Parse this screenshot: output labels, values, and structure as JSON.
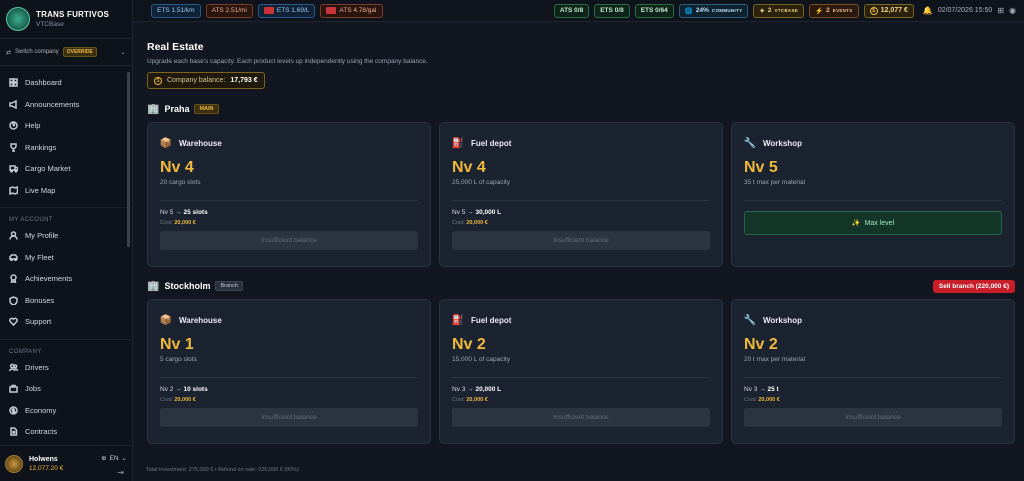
{
  "brand": {
    "title": "TRANS FURTIVOS",
    "subtitle": "VTCBase"
  },
  "switch": {
    "label": "Switch company",
    "badge": "OVERRIDE"
  },
  "nav": {
    "main": [
      {
        "label": "Dashboard",
        "icon": "grid-icon"
      },
      {
        "label": "Announcements",
        "icon": "megaphone-icon"
      },
      {
        "label": "Help",
        "icon": "help-icon"
      },
      {
        "label": "Rankings",
        "icon": "trophy-icon"
      },
      {
        "label": "Cargo Market",
        "icon": "truck-icon"
      },
      {
        "label": "Live Map",
        "icon": "map-icon"
      }
    ],
    "account_title": "MY ACCOUNT",
    "account": [
      {
        "label": "My Profile",
        "icon": "user-icon"
      },
      {
        "label": "My Fleet",
        "icon": "car-icon"
      },
      {
        "label": "Achievements",
        "icon": "badge-icon"
      },
      {
        "label": "Bonuses",
        "icon": "shield-icon"
      },
      {
        "label": "Support",
        "icon": "heart-icon"
      }
    ],
    "company_title": "COMPANY",
    "company": [
      {
        "label": "Drivers",
        "icon": "users-icon"
      },
      {
        "label": "Jobs",
        "icon": "briefcase-icon"
      },
      {
        "label": "Economy",
        "icon": "dollar-icon"
      },
      {
        "label": "Contracts",
        "icon": "document-icon"
      }
    ]
  },
  "user": {
    "name": "Holwens",
    "balance": "12,077.20 €",
    "lang": "EN"
  },
  "topbar": {
    "ets_rate": "ETS 1.51/km",
    "ats_rate": "ATS 2.51/mi",
    "ets_fuel": "ETS 1.69/L",
    "ats_fuel": "ATS 4.78/gal",
    "ats_stat": "ATS 0/8",
    "ets_stat": "ETS 0/8",
    "ets_stat2": "ETS 0/64",
    "community_value": "24%",
    "community_label": "COMMUNITY",
    "vtcbase_value": "2",
    "vtcbase_label": "VTCBASE",
    "events_value": "2",
    "events_label": "EVENTS",
    "money": "12,077 €",
    "date": "02/07/2026 15:50"
  },
  "page": {
    "title": "Real Estate",
    "description": "Upgrade each base's capacity. Each product levels up independently using the company balance.",
    "balance_label": "Company balance:",
    "balance_value": "17,793 €"
  },
  "bases": [
    {
      "name": "Praha",
      "tag": "MAIN",
      "cards": [
        {
          "name": "Warehouse",
          "icon": "box-icon",
          "level": "Nv 4",
          "capacity": "20 cargo slots",
          "next": "Nv 5 → ",
          "next_value": "25 slots",
          "cost_label": "Cost: ",
          "cost": "20,000 €",
          "button": "Insufficient balance"
        },
        {
          "name": "Fuel depot",
          "icon": "fuel-icon",
          "level": "Nv 4",
          "capacity": "25,000 L of capacity",
          "next": "Nv 5 → ",
          "next_value": "30,000 L",
          "cost_label": "Cost: ",
          "cost": "20,000 €",
          "button": "Insufficient balance"
        },
        {
          "name": "Workshop",
          "icon": "wrench-icon",
          "level": "Nv 5",
          "capacity": "35 t max per material",
          "max_label": "Max level"
        }
      ]
    },
    {
      "name": "Stockholm",
      "tag": "Branch",
      "sell": "Sell branch (220,000 €)",
      "cards": [
        {
          "name": "Warehouse",
          "icon": "box-icon",
          "level": "Nv 1",
          "capacity": "5 cargo slots",
          "next": "Nv 2 → ",
          "next_value": "10 slots",
          "cost_label": "Cost: ",
          "cost": "20,000 €",
          "button": "Insufficient balance"
        },
        {
          "name": "Fuel depot",
          "icon": "fuel-icon",
          "level": "Nv 2",
          "capacity": "15,000 L of capacity",
          "next": "Nv 3 → ",
          "next_value": "20,000 L",
          "cost_label": "Cost: ",
          "cost": "20,000 €",
          "button": "Insufficient balance"
        },
        {
          "name": "Workshop",
          "icon": "wrench-icon",
          "level": "Nv 2",
          "capacity": "20 t max per material",
          "next": "Nv 3 → ",
          "next_value": "25 t",
          "cost_label": "Cost: ",
          "cost": "20,000 €",
          "button": "Insufficient balance"
        }
      ]
    }
  ],
  "footer": "Total investment: 275,000 € • Refund on sale: 220,000 € (80%)"
}
